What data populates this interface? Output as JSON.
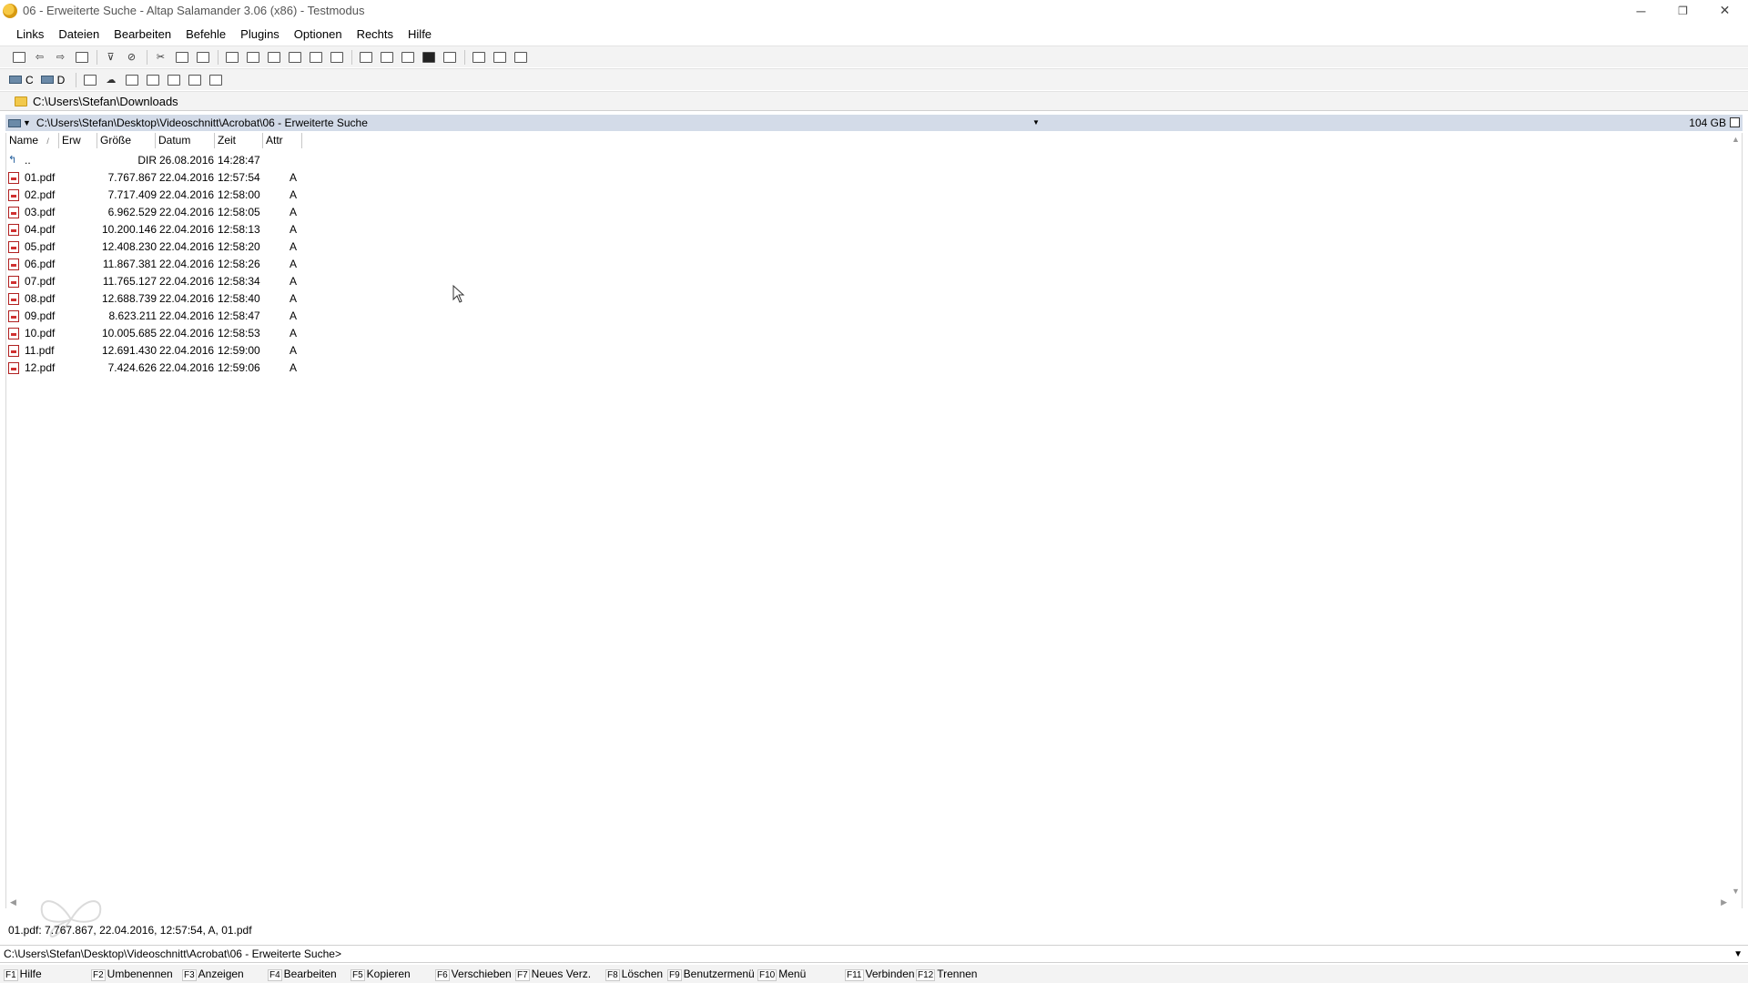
{
  "window": {
    "title": "06 - Erweiterte Suche - Altap Salamander 3.06 (x86) - Testmodus",
    "minimize": "─",
    "restore": "❐",
    "close": "✕"
  },
  "menu": [
    "Links",
    "Dateien",
    "Bearbeiten",
    "Befehle",
    "Plugins",
    "Optionen",
    "Rechts",
    "Hilfe"
  ],
  "drives": {
    "c": "C",
    "d": "D"
  },
  "hotpath": "C:\\Users\\Stefan\\Downloads",
  "panel": {
    "path": "C:\\Users\\Stefan\\Desktop\\Videoschnitt\\Acrobat\\06 - Erweiterte Suche",
    "free_space": "104 GB",
    "columns": {
      "name": "Name",
      "sort_marker": "/",
      "ext": "Erw",
      "size": "Größe",
      "date": "Datum",
      "time": "Zeit",
      "attr": "Attr"
    },
    "updir": {
      "name": "..",
      "size": "DIR",
      "date": "26.08.2016",
      "time": "14:28:47",
      "attr": ""
    },
    "files": [
      {
        "name": "01.pdf",
        "size": "7.767.867",
        "date": "22.04.2016",
        "time": "12:57:54",
        "attr": "A"
      },
      {
        "name": "02.pdf",
        "size": "7.717.409",
        "date": "22.04.2016",
        "time": "12:58:00",
        "attr": "A"
      },
      {
        "name": "03.pdf",
        "size": "6.962.529",
        "date": "22.04.2016",
        "time": "12:58:05",
        "attr": "A"
      },
      {
        "name": "04.pdf",
        "size": "10.200.146",
        "date": "22.04.2016",
        "time": "12:58:13",
        "attr": "A"
      },
      {
        "name": "05.pdf",
        "size": "12.408.230",
        "date": "22.04.2016",
        "time": "12:58:20",
        "attr": "A"
      },
      {
        "name": "06.pdf",
        "size": "11.867.381",
        "date": "22.04.2016",
        "time": "12:58:26",
        "attr": "A"
      },
      {
        "name": "07.pdf",
        "size": "11.765.127",
        "date": "22.04.2016",
        "time": "12:58:34",
        "attr": "A"
      },
      {
        "name": "08.pdf",
        "size": "12.688.739",
        "date": "22.04.2016",
        "time": "12:58:40",
        "attr": "A"
      },
      {
        "name": "09.pdf",
        "size": "8.623.211",
        "date": "22.04.2016",
        "time": "12:58:47",
        "attr": "A"
      },
      {
        "name": "10.pdf",
        "size": "10.005.685",
        "date": "22.04.2016",
        "time": "12:58:53",
        "attr": "A"
      },
      {
        "name": "11.pdf",
        "size": "12.691.430",
        "date": "22.04.2016",
        "time": "12:59:00",
        "attr": "A"
      },
      {
        "name": "12.pdf",
        "size": "7.424.626",
        "date": "22.04.2016",
        "time": "12:59:06",
        "attr": "A"
      }
    ]
  },
  "status_line": "01.pdf: 7.767.867, 22.04.2016, 12:57:54, A, 01.pdf",
  "command_line": "C:\\Users\\Stefan\\Desktop\\Videoschnitt\\Acrobat\\06 - Erweiterte Suche>",
  "fkeys": [
    {
      "key": "F1",
      "label": "Hilfe"
    },
    {
      "key": "F2",
      "label": "Umbenennen"
    },
    {
      "key": "F3",
      "label": "Anzeigen"
    },
    {
      "key": "F4",
      "label": "Bearbeiten"
    },
    {
      "key": "F5",
      "label": "Kopieren"
    },
    {
      "key": "F6",
      "label": "Verschieben"
    },
    {
      "key": "F7",
      "label": "Neues Verz."
    },
    {
      "key": "F8",
      "label": "Löschen"
    },
    {
      "key": "F9",
      "label": "Benutzermenü"
    },
    {
      "key": "F10",
      "label": "Menü"
    },
    {
      "key": "F11",
      "label": "Verbinden"
    },
    {
      "key": "F12",
      "label": "Trennen"
    }
  ]
}
